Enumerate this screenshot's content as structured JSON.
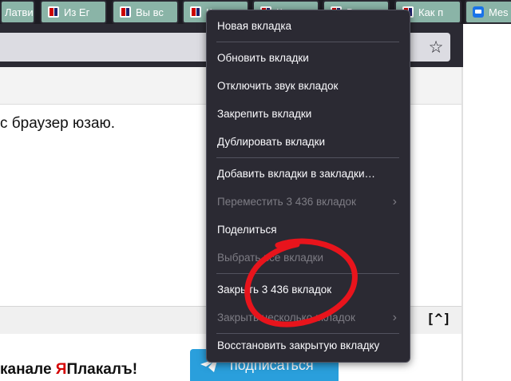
{
  "tabs": [
    {
      "label": "Латви",
      "icon": "yaplakal-favicon"
    },
    {
      "label": "Из Ег",
      "icon": "yaplakal-favicon"
    },
    {
      "label": "Вы вс",
      "icon": "yaplakal-favicon"
    },
    {
      "label": "Кт",
      "icon": "yaplakal-favicon"
    },
    {
      "label": "К",
      "icon": "yaplakal-favicon"
    },
    {
      "label": "В",
      "icon": "yaplakal-favicon"
    },
    {
      "label": "Как п",
      "icon": "yaplakal-favicon"
    },
    {
      "label": "Mes",
      "icon": "chat-favicon"
    }
  ],
  "page": {
    "post_text": "с браузер юзаю.",
    "scroll_top_label": "[^]",
    "promo_prefix": "канале ",
    "promo_brand_first": "Я",
    "promo_brand_rest": "Плакалъ!",
    "subscribe_label": "подписаться"
  },
  "context_menu": {
    "items": [
      {
        "label": "Новая вкладка",
        "enabled": true
      },
      {
        "label": "Обновить вкладки",
        "enabled": true
      },
      {
        "label": "Отключить звук вкладок",
        "enabled": true
      },
      {
        "label": "Закрепить вкладки",
        "enabled": true
      },
      {
        "label": "Дублировать вкладки",
        "enabled": true
      },
      {
        "label": "Добавить вкладки в закладки…",
        "enabled": true
      },
      {
        "label": "Переместить 3 436 вкладок",
        "enabled": false,
        "submenu": true
      },
      {
        "label": "Поделиться",
        "enabled": true
      },
      {
        "label": "Выбрать все вкладки",
        "enabled": false
      },
      {
        "label": "Закрыть 3 436 вкладок",
        "enabled": true
      },
      {
        "label": "Закрыть несколько вкладок",
        "enabled": false,
        "submenu": true
      },
      {
        "label": "Восстановить закрытую вкладку",
        "enabled": true
      }
    ]
  },
  "colors": {
    "menu_bg": "#2b2a33",
    "tab_bg": "#8ab4a7",
    "annotation": "#e8141c",
    "subscribe_bg": "#2a9fdc"
  },
  "icons": {
    "bookmark": "star-icon",
    "submenu": "chevron-right-icon",
    "subscribe": "telegram-plane-icon"
  }
}
